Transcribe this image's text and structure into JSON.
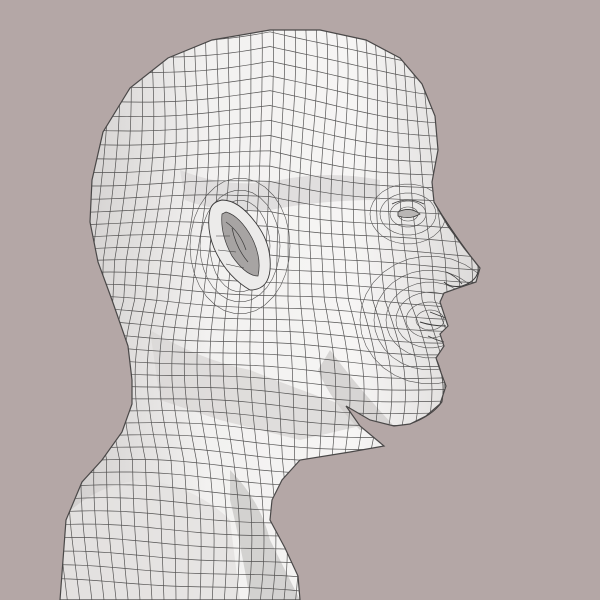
{
  "scene": {
    "subject": "wireframe-head-bust-profile",
    "view": "right-side-profile",
    "render_style": "gray-shaded-mesh-with-dark-edges",
    "colors": {
      "background": "#b4a7a6",
      "surface": "#f1f0ef",
      "shade": "#d5d3d2",
      "deep_shade": "#a9a6a5",
      "wire": "#3b3a3a"
    }
  }
}
